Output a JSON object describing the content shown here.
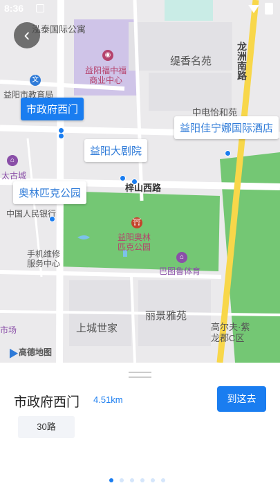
{
  "status_bar": {
    "time": "8:36"
  },
  "map": {
    "back_label": "‹",
    "callouts": {
      "selected": "市政府西门",
      "grand_theater": "益阳大剧院",
      "olympic_park": "奥林匹克公园",
      "hotel": "益阳佳宁娜国际酒店"
    },
    "places": {
      "hongtai": "泓泰国际公寓",
      "shopping": "益阳福中福\n商业中心",
      "tixiang": "缇香名苑",
      "longzhou_road": "龙洲南路",
      "zhongyi": "中电怡和苑",
      "yiyang_edu": "益阳市教育局",
      "taigu": "太古城",
      "zishan_road": "梓山西路",
      "bank": "中国人民银行",
      "park_center": "益阳奥林\n匹克公园",
      "phone_repair": "手机维修\n服务中心",
      "batu": "巴图鲁体育",
      "shangcheng": "上城世家",
      "lijing": "丽景雅苑",
      "golf": "高尔夫·紫\n龙郡C区",
      "market": "市场"
    },
    "logo_text": "高德地图"
  },
  "sheet": {
    "stop_name": "市政府西门",
    "distance": "4.51km",
    "goto_label": "到这去",
    "routes": [
      "30路"
    ],
    "pager": {
      "count": 6,
      "active": 0
    }
  },
  "colors": {
    "accent": "#1a7df0",
    "park": "#74c774",
    "road_major": "#f8d74a",
    "purple_block": "#cfc4e8"
  }
}
